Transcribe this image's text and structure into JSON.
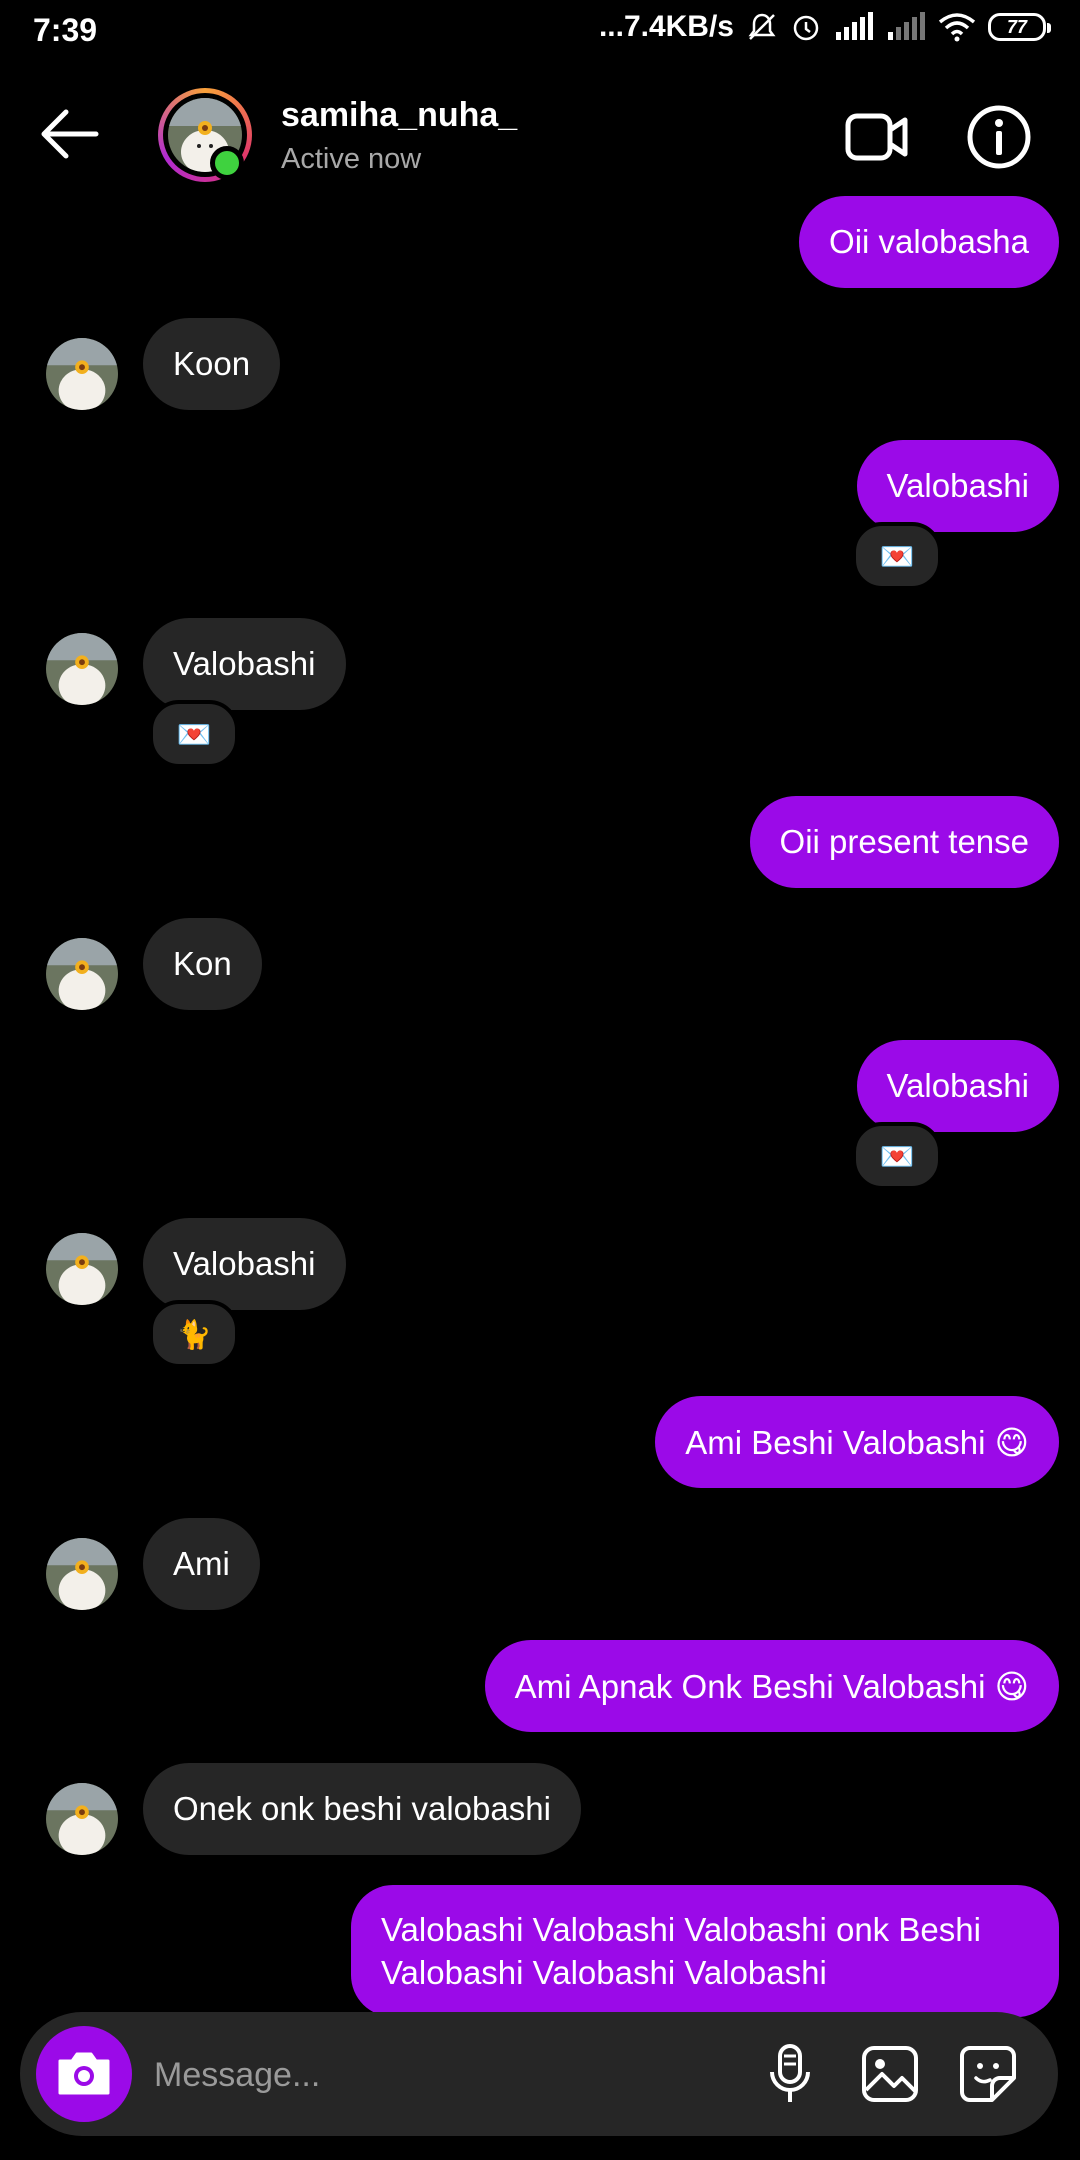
{
  "status_bar": {
    "time": "7:39",
    "network_speed": "...7.4KB/s",
    "battery": "77"
  },
  "header": {
    "username": "samiha_nuha_",
    "status": "Active now"
  },
  "messages": [
    {
      "direction": "out",
      "text": "Oii valobasha"
    },
    {
      "direction": "in",
      "text": "Koon"
    },
    {
      "direction": "out",
      "text": "Valobashi",
      "reaction": "💌"
    },
    {
      "direction": "in",
      "text": "Valobashi",
      "reaction": "💌"
    },
    {
      "direction": "out",
      "text": "Oii present tense"
    },
    {
      "direction": "in",
      "text": "Kon"
    },
    {
      "direction": "out",
      "text": "Valobashi",
      "reaction": "💌"
    },
    {
      "direction": "in",
      "text": "Valobashi",
      "reaction": "🐈"
    },
    {
      "direction": "out",
      "text": "Ami Beshi Valobashi 😋"
    },
    {
      "direction": "in",
      "text": "Ami"
    },
    {
      "direction": "out",
      "text": "Ami Apnak Onk Beshi Valobashi 😋"
    },
    {
      "direction": "in",
      "text": "Onek onk beshi valobashi"
    },
    {
      "direction": "out",
      "text": "Valobashi Valobashi Valobashi onk Beshi Valobashi Valobashi Valobashi"
    }
  ],
  "composer": {
    "placeholder": "Message..."
  },
  "colors": {
    "outgoing_bubble": "#9b0ae8",
    "incoming_bubble": "#262626",
    "online_dot": "#3fd23f"
  }
}
